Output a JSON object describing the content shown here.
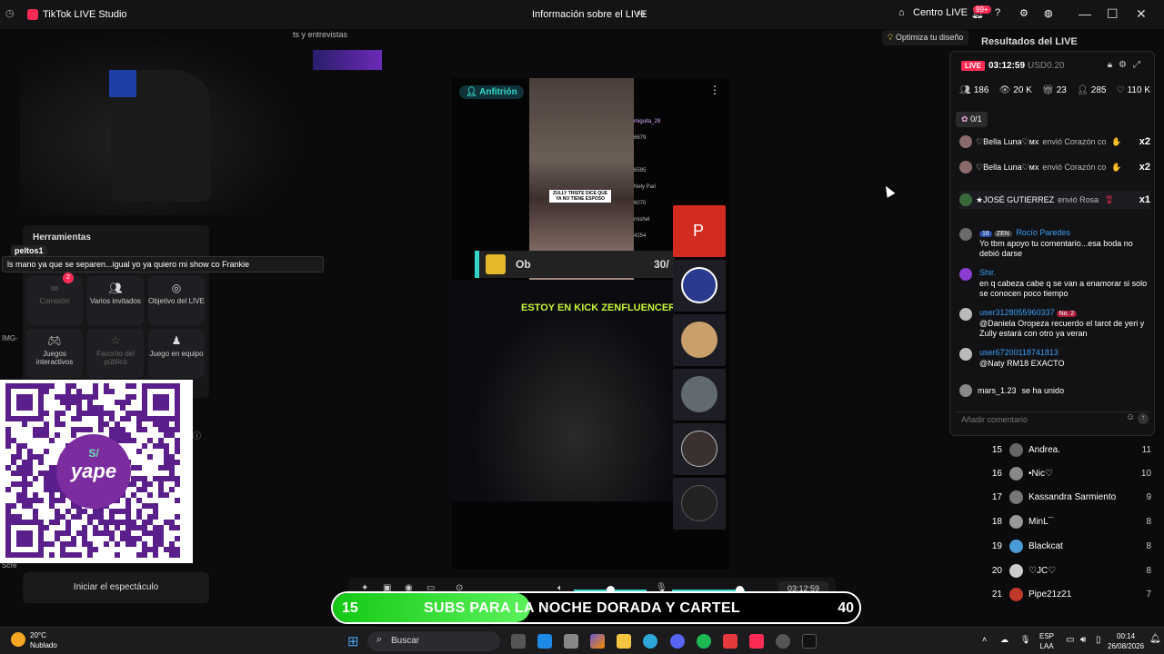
{
  "window": {
    "app_title": "TikTok LIVE Studio",
    "center_title": "Información sobre el LIVE",
    "centro_live": "Centro LIVE",
    "notif_badge": "99+"
  },
  "left": {
    "tab_strip": "ts y entrevistas",
    "tools_title": "Herramientas",
    "tools": [
      {
        "label": "Comisión",
        "icon": "link-icon",
        "badge": "2",
        "enabled": false
      },
      {
        "label": "Varios invitados",
        "icon": "users-icon",
        "enabled": true
      },
      {
        "label": "Objetivo del LIVE",
        "icon": "target-icon",
        "enabled": true
      },
      {
        "label": "Juegos interactivos",
        "icon": "gamepad-icon",
        "enabled": true
      },
      {
        "label": "Favorito del público",
        "icon": "star-icon",
        "enabled": false
      },
      {
        "label": "Juego en equipo",
        "icon": "team-icon",
        "enabled": true
      }
    ],
    "chat_popup_user": "peltos1",
    "chat_popup_text": "ls mano ya que se separen...igual yo ya quiero mi show co Frankie",
    "side_label": "IMG-",
    "side_label2": "Scre",
    "qr_brand": "yape",
    "start_button": "Iniciar el espectáculo"
  },
  "stage": {
    "host_label": "Anfitrión",
    "mini_caption": "ZULLY TRISTE DICE QUE YA NO TIENE ESPOSO",
    "mini_chat": [
      "miguita_28",
      "6679",
      "6595",
      "Nely Pari",
      "6070",
      "mishel",
      "4254"
    ],
    "kick_text": "Ob",
    "kick_count": "30/",
    "caption": "ESTOY EN KICK ZENFLUENCER",
    "guests": [
      {
        "initial": "P",
        "color": "#d22b1f"
      },
      {
        "initial": "",
        "color": "#2a3b8f"
      },
      {
        "initial": "",
        "color": "#c9a06b"
      },
      {
        "initial": "",
        "color": "#606a70"
      },
      {
        "initial": "",
        "color": "#3a3030"
      },
      {
        "initial": "",
        "color": "#222"
      }
    ]
  },
  "toolbar": {
    "timer": "03:12:59"
  },
  "subs_goal": {
    "current": "15",
    "text": "SUBS PARA LA NOCHE DORADA Y CARTEL",
    "goal": "40",
    "progress": 0.375
  },
  "right": {
    "optimiza": "Optimiza tu diseño",
    "results_title": "Resultados del LIVE",
    "live_badge": "LIVE",
    "live_time": "03:12:59",
    "live_usd": "USD0.20",
    "stats": [
      {
        "icon": "users-icon",
        "value": "186"
      },
      {
        "icon": "eye-icon",
        "value": "20 K"
      },
      {
        "icon": "gift-icon",
        "value": "23"
      },
      {
        "icon": "follow-icon",
        "value": "285"
      },
      {
        "icon": "heart-icon",
        "value": "110 K"
      }
    ],
    "goal_chip": "0/1",
    "gifts": [
      {
        "name": "♡Bella Luna♡ᴍx",
        "action": "envió Corazón co",
        "mult": "x2"
      },
      {
        "name": "♡Bella Luna♡ᴍx",
        "action": "envió Corazón co",
        "mult": "x2"
      },
      {
        "name": "★JOSÉ GUTIERREZ",
        "action": "envió Rosa",
        "mult": "x1"
      }
    ],
    "comments": [
      {
        "name": "Rocío Paredes",
        "level": "16",
        "tag": "ZEN",
        "text": "Yo tbm apoyo tu comentario...esa boda no debió darse"
      },
      {
        "name": "Shir.",
        "level": "",
        "tag": "",
        "text": "en q cabeza cabe q se van a enamorar si solo se conocen poco tiempo"
      },
      {
        "name": "user3128055960337",
        "level": "",
        "tag": "No. 2",
        "text": "@Daniela Oropeza recuerdo el tarot de yeri y Zully estará con otro ya veran"
      },
      {
        "name": "user67200118741813",
        "level": "",
        "tag": "",
        "text": "@Naty RM18 EXACTO"
      }
    ],
    "joined_user": "mars_1.23",
    "joined_text": "se ha unido",
    "comment_placeholder": "Añadir comentario",
    "ranking": [
      {
        "rank": "15",
        "name": "Andrea.",
        "score": "11",
        "color": "#666"
      },
      {
        "rank": "16",
        "name": "•Nic♡",
        "score": "10",
        "color": "#888"
      },
      {
        "rank": "17",
        "name": "Kassandra Sarmiento",
        "score": "9",
        "color": "#777"
      },
      {
        "rank": "18",
        "name": "MinL¯",
        "score": "8",
        "color": "#999"
      },
      {
        "rank": "19",
        "name": "Blackcat",
        "score": "8",
        "color": "#4a9ad6"
      },
      {
        "rank": "20",
        "name": "♡JC♡",
        "score": "8",
        "color": "#ccc"
      },
      {
        "rank": "21",
        "name": "Pipe21z21",
        "score": "7",
        "color": "#c0392b"
      }
    ]
  },
  "taskbar": {
    "temp": "20°C",
    "weather": "Nublado",
    "search": "Buscar",
    "lang1": "ESP",
    "lang2": "LAA",
    "time": "00:14",
    "date": "26/08/2026"
  }
}
